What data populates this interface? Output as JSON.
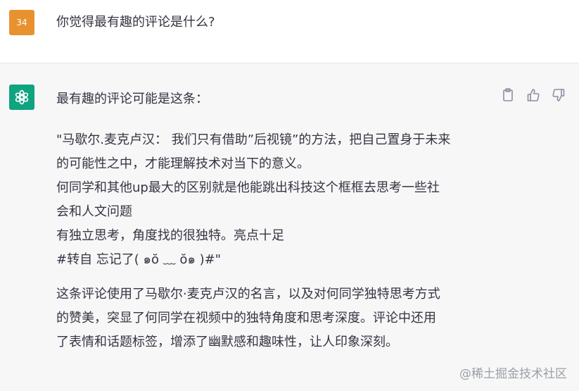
{
  "user_message": {
    "avatar_label": "34",
    "avatar_color": "#e8922f",
    "text": "你觉得最有趣的评论是什么?"
  },
  "assistant_message": {
    "avatar_icon": "openai-logo-icon",
    "avatar_color": "#10a37f",
    "intro": "最有趣的评论可能是这条：",
    "quote": "\"马歇尔.麦克卢汉： 我们只有借助”后视镜”的方法，把自己置身于未来\n的可能性之中，才能理解技术对当下的意义。\n何同学和其他up最大的区别就是他能跳出科技这个框框去思考一些社\n会和人文问题\n有独立思考，角度找的很独特。亮点十足\n#转自 忘记了( ๑ŏ ﹏ ŏ๑ )#\"",
    "explanation": "这条评论使用了马歇尔·麦克卢汉的名言，以及对何同学独特思考方式\n的赞美，突显了何同学在视频中的独特角度和思考深度。评论中还用\n了表情和话题标签，增添了幽默感和趣味性，让人印象深刻。"
  },
  "actions": {
    "icons": [
      "copy-icon",
      "thumbs-up-icon",
      "thumbs-down-icon"
    ]
  },
  "watermark": "@稀土掘金技术社区"
}
